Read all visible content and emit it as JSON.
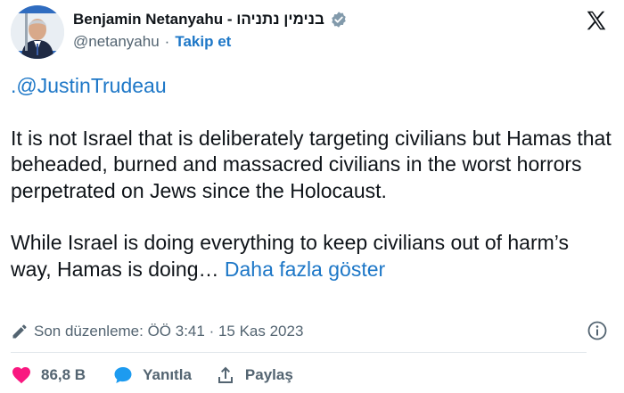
{
  "author": {
    "display_name": "Benjamin Netanyahu - בנימין נתניהו",
    "handle": "@netanyahu",
    "separator": "·",
    "follow_label": "Takip et",
    "verified": true
  },
  "tweet": {
    "mention": ".@JustinTrudeau",
    "paragraph1": "It is not Israel that is deliberately targeting civilians but Hamas that beheaded, burned and massacred civilians in the worst horrors perpetrated on Jews since the Holocaust.",
    "paragraph2": "While Israel is doing everything to keep civilians out of harm’s way, Hamas is doing…",
    "show_more": "Daha fazla göster"
  },
  "meta": {
    "edited_label": "Son düzenleme: ÖÖ 3:41 · 15 Kas 2023"
  },
  "actions": {
    "likes": "86,8 B",
    "reply_label": "Yanıtla",
    "share_label": "Paylaş"
  },
  "colors": {
    "accent": "#1d9bf0",
    "link": "#1d77c7",
    "heart": "#f91880",
    "text": "#0f1419",
    "muted": "#536471"
  },
  "icons": [
    "verified-badge-icon",
    "x-logo-icon",
    "pencil-icon",
    "info-icon",
    "heart-icon",
    "reply-bubble-icon",
    "share-icon"
  ]
}
